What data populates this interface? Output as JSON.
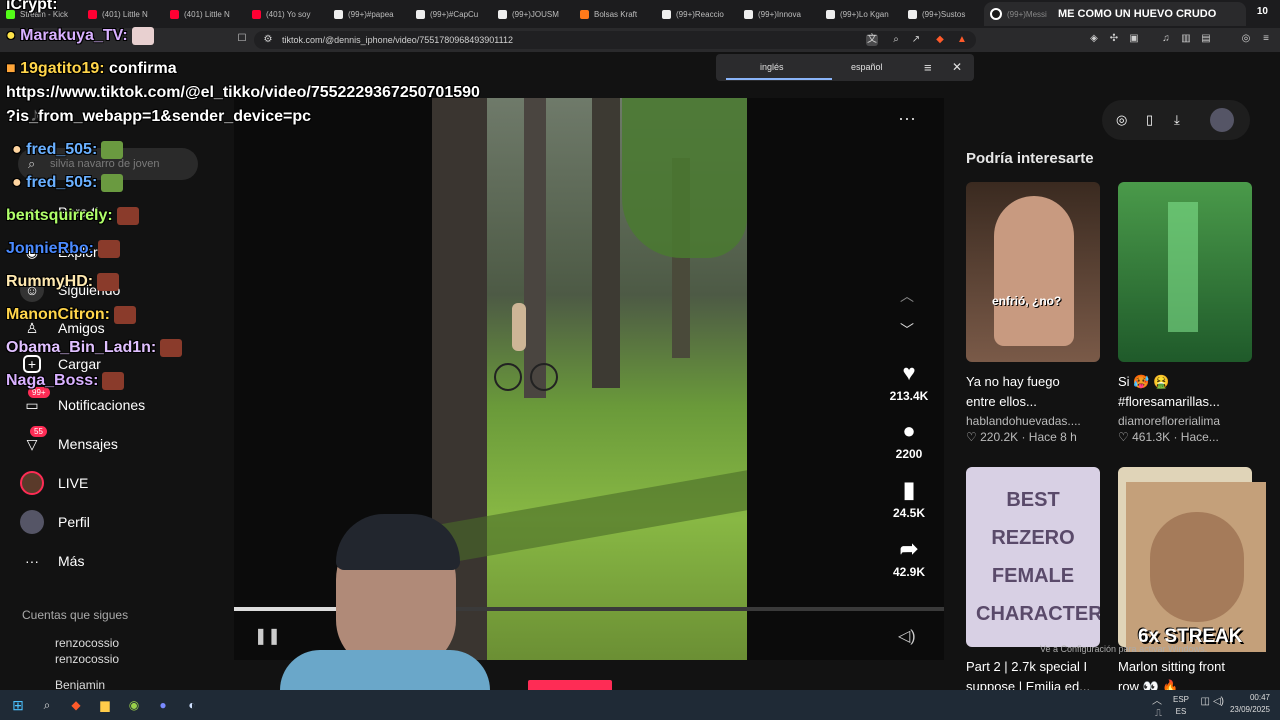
{
  "browser": {
    "tabs": [
      {
        "label": "Stream - Kick",
        "color": "#53fc18"
      },
      {
        "label": "(401) Little N",
        "color": "#ff0033"
      },
      {
        "label": "(401) Little N",
        "color": "#ff0033"
      },
      {
        "label": "(401) Yo soy",
        "color": "#ff0033"
      },
      {
        "label": "(99+)#papea",
        "color": "#ffffff"
      },
      {
        "label": "(99+)#CapCu",
        "color": "#ffffff"
      },
      {
        "label": "(99+)JOUSM",
        "color": "#ffffff"
      },
      {
        "label": "Bolsas Kraft",
        "color": "#ff7a1a"
      },
      {
        "label": "(99+)Reaccio",
        "color": "#ffffff"
      },
      {
        "label": "(99+)Innova",
        "color": "#ffffff"
      },
      {
        "label": "(99+)Lo Kgan",
        "color": "#ffffff"
      },
      {
        "label": "(99+)Sustos",
        "color": "#ffffff"
      },
      {
        "label": "(99+)Messi",
        "color": "#ffffff"
      }
    ],
    "active_tab_title": "ME COMO UN HUEVO CRUDO",
    "tab_count": "10",
    "url": "tiktok.com/@dennis_iphone/video/7551780968493901112"
  },
  "translate": {
    "lang_from": "inglés",
    "lang_to": "español"
  },
  "sidebar": {
    "search_placeholder": "silvia navarro de joven",
    "items": [
      {
        "label": "Para ti",
        "icon": "home-icon"
      },
      {
        "label": "Explorar",
        "icon": "compass-icon"
      },
      {
        "label": "Siguiendo",
        "icon": "following-icon"
      },
      {
        "label": "Amigos",
        "icon": "friends-icon"
      },
      {
        "label": "Cargar",
        "icon": "upload-icon"
      },
      {
        "label": "Notificaciones",
        "icon": "bell-icon",
        "badge": "99+"
      },
      {
        "label": "Mensajes",
        "icon": "message-icon",
        "badge": "55"
      },
      {
        "label": "LIVE",
        "icon": "live-icon"
      },
      {
        "label": "Perfil",
        "icon": "profile-icon"
      },
      {
        "label": "Más",
        "icon": "more-icon"
      }
    ],
    "following_title": "Cuentas que sigues",
    "following": [
      {
        "name": "renzocossio",
        "handle": "renzocossio"
      },
      {
        "name": "Benjamin",
        "handle": ""
      }
    ]
  },
  "video": {
    "likes": "213.4K",
    "comments": "2200",
    "saves": "24.5K",
    "shares": "42.9K",
    "progress": 0.16
  },
  "recommendations": {
    "title": "Podría interesarte",
    "cards": [
      {
        "caption": "Ya no hay fuego",
        "caption2": "entre ellos...",
        "author": "hablandohuevadas....",
        "stats": "♡ 220.2K · Hace 8 h",
        "overlay": "enfrió, ¿no?",
        "color": "#6a4b3a"
      },
      {
        "caption": "Si 🥵 🤮",
        "caption2": "#floresamarillas...",
        "author": "diamoreflorerialima",
        "stats": "♡ 461.3K · Hace...",
        "overlay": "",
        "color": "#2a7a3a"
      },
      {
        "caption": "Part 2 | 2.7k special I",
        "caption2": "suppose | Emilia ed...",
        "author": "",
        "stats": "",
        "overlay": "BEST REZERO FEMALE CHARACTERS",
        "color": "#c9c0d8"
      },
      {
        "caption": "Marlon sitting front",
        "caption2": "row 👀 🔥",
        "author": "",
        "stats": "",
        "overlay": "",
        "color": "#d9c9a8"
      }
    ]
  },
  "stream_overlay": {
    "streak": "6x STREAK",
    "activation_notice": "Ve a Configuración para activar Windows.",
    "chat": [
      {
        "user": "iCrypt:",
        "text": "",
        "color": "#ffffff"
      },
      {
        "user": "Marakuya_TV:",
        "text": "",
        "color": "#d8b0ff"
      },
      {
        "user": "19gatito19:",
        "text": "confirma",
        "color": "#ffd54a"
      },
      {
        "user": "",
        "text": "https://www.tiktok.com/@el_tikko/video/7552229367250701590",
        "color": "#ffffff"
      },
      {
        "user": "",
        "text": "?is_from_webapp=1&sender_device=pc",
        "color": "#ffffff"
      },
      {
        "user": "fred_505:",
        "text": "",
        "color": "#6ab0ff"
      },
      {
        "user": "fred_505:",
        "text": "",
        "color": "#6ab0ff"
      },
      {
        "user": "bentsquirrely:",
        "text": "",
        "color": "#b0ff6a"
      },
      {
        "user": "JonnieRbo:",
        "text": "",
        "color": "#4a8aff"
      },
      {
        "user": "RummyHD:",
        "text": "",
        "color": "#ffe9b0"
      },
      {
        "user": "ManonCitron:",
        "text": "",
        "color": "#ffd54a"
      },
      {
        "user": "Obama_Bin_Lad1n:",
        "text": "",
        "color": "#e0c0ff"
      },
      {
        "user": "Naga_Boss:",
        "text": "",
        "color": "#d8b0ff"
      }
    ]
  },
  "taskbar": {
    "lang": "ESP",
    "lang2": "ES",
    "time": "00:47",
    "date": "23/09/2025"
  }
}
